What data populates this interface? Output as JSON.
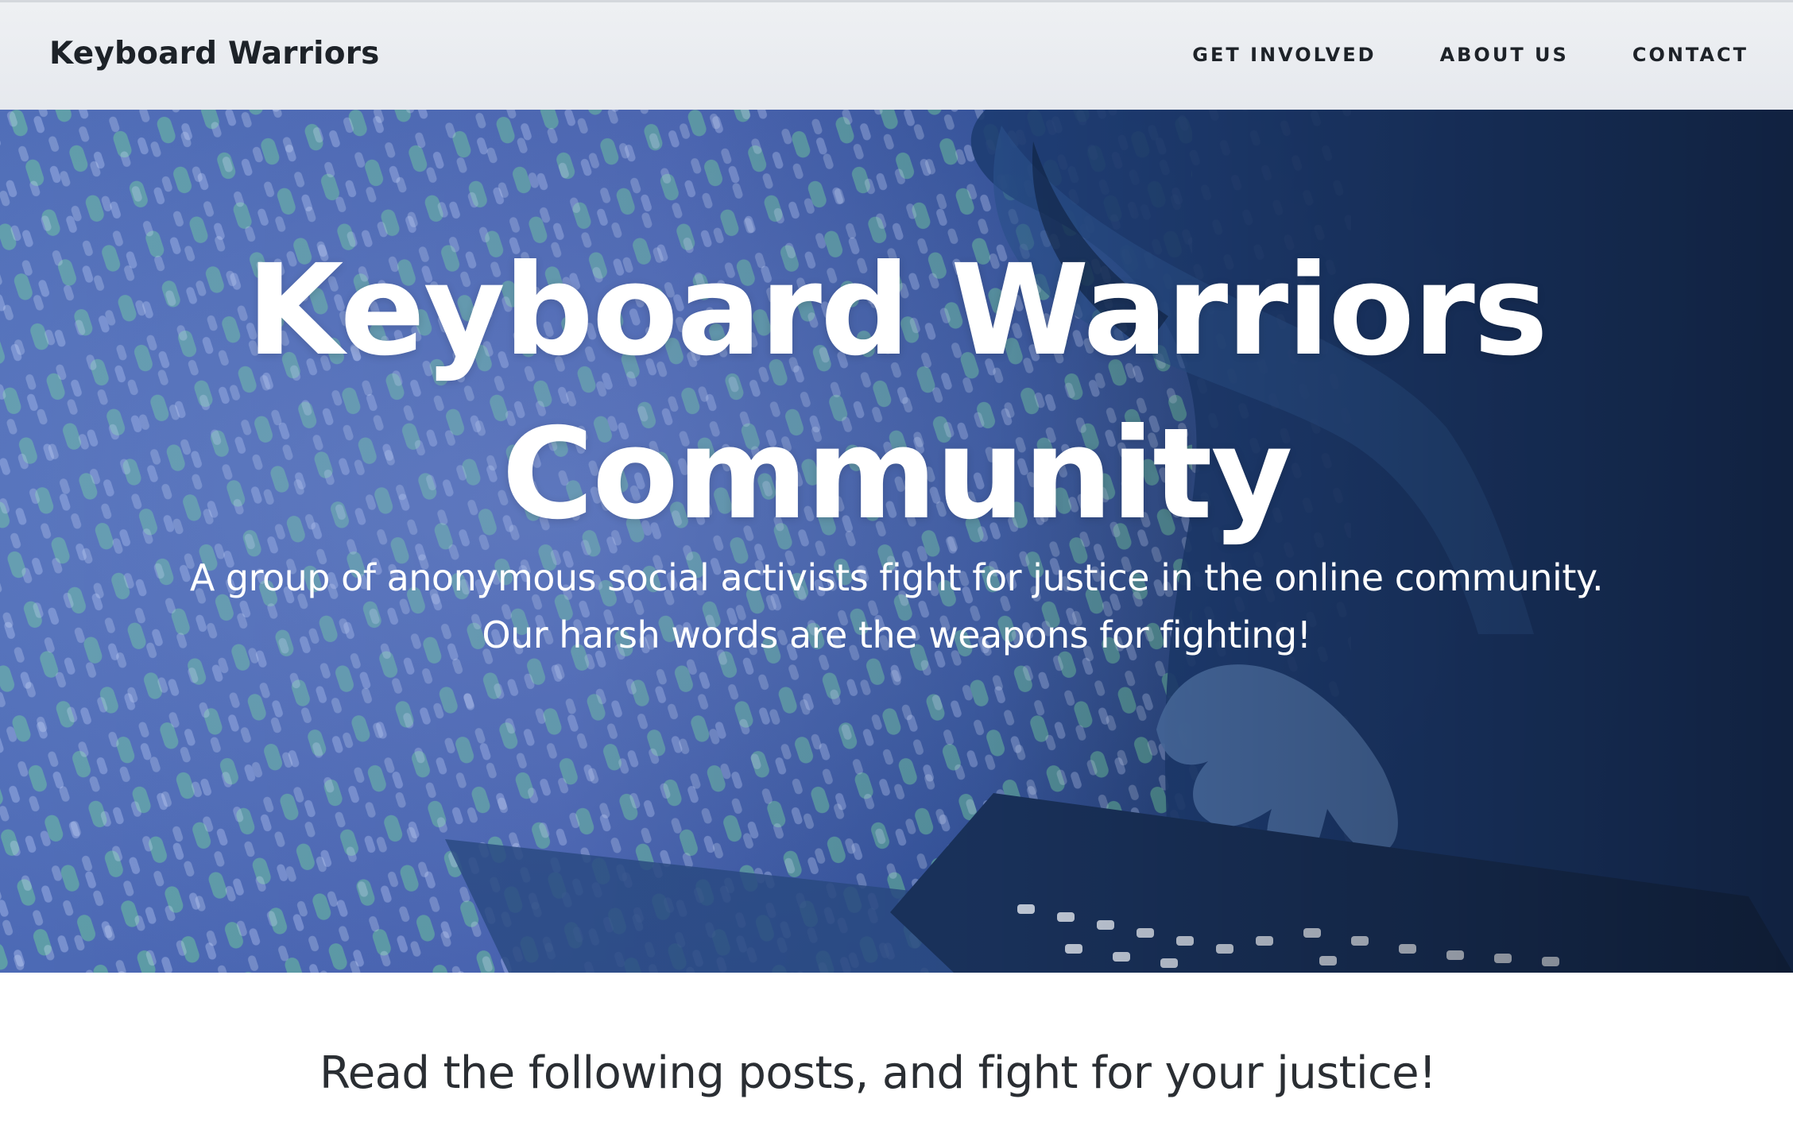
{
  "navbar": {
    "brand": "Keyboard Warriors",
    "links": [
      {
        "label": "GET INVOLVED"
      },
      {
        "label": "ABOUT US"
      },
      {
        "label": "CONTACT"
      }
    ]
  },
  "hero": {
    "title_line1": "Keyboard Warriors",
    "title_line2": "Community",
    "subtitle_line1": "A group of anonymous social activists fight for justice in the online community.",
    "subtitle_line2": "Our harsh words are the weapons for fighting!",
    "image": "hooded-person-typing-on-laptop"
  },
  "main": {
    "intro": "Read the following posts, and fight for your justice!"
  },
  "colors": {
    "nav_bg": "#e9ecf0",
    "hero_blue": "#3d5aa8",
    "text_dark": "#1d2228",
    "accent_green": "#5fbf8a"
  }
}
